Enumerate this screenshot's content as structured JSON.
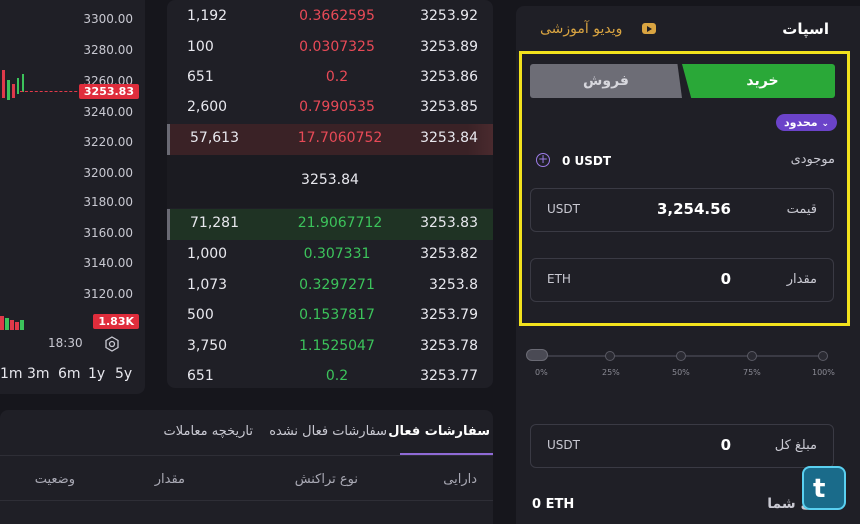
{
  "chart": {
    "y_ticks": [
      "3300.00",
      "3280.00",
      "3260.00",
      "3240.00",
      "3220.00",
      "3200.00",
      "3180.00",
      "3160.00",
      "3140.00",
      "3120.00"
    ],
    "last_price_tag": "3253.83",
    "volume_tag": "1.83K",
    "time_label": "18:30",
    "timeframes": [
      "1m",
      "3m",
      "6m",
      "1y",
      "5y"
    ]
  },
  "order_book": {
    "asks": [
      {
        "amount": "1,192",
        "total": "0.3662595",
        "price": "3253.92"
      },
      {
        "amount": "100",
        "total": "0.0307325",
        "price": "3253.89"
      },
      {
        "amount": "651",
        "total": "0.2",
        "price": "3253.86"
      },
      {
        "amount": "2,600",
        "total": "0.7990535",
        "price": "3253.85"
      },
      {
        "amount": "57,613",
        "total": "17.7060752",
        "price": "3253.84"
      }
    ],
    "mid_price": "3253.84",
    "bids": [
      {
        "amount": "71,281",
        "total": "21.9067712",
        "price": "3253.83"
      },
      {
        "amount": "1,000",
        "total": "0.307331",
        "price": "3253.82"
      },
      {
        "amount": "1,073",
        "total": "0.3297271",
        "price": "3253.8"
      },
      {
        "amount": "500",
        "total": "0.1537817",
        "price": "3253.79"
      },
      {
        "amount": "3,750",
        "total": "1.1525047",
        "price": "3253.78"
      },
      {
        "amount": "651",
        "total": "0.2",
        "price": "3253.77"
      }
    ]
  },
  "orders": {
    "tabs": {
      "active": "سفارشات فعال",
      "inactive": "سفارشات فعال نشده",
      "history": "تاریخچه معاملات"
    },
    "columns": {
      "asset": "دارایی",
      "type": "نوع تراکنش",
      "amount": "مقدار",
      "status": "وضعیت"
    }
  },
  "spot": {
    "title": "اسپات",
    "video_link": "ویدیو آموزشی",
    "buy_label": "خرید",
    "sell_label": "فروش",
    "order_type": "محدود",
    "balance_label": "موجودی",
    "balance_value": "0 USDT",
    "price_label": "قیمت",
    "price_value": "3,254.56",
    "price_unit": "USDT",
    "amount_label": "مقدار",
    "amount_value": "0",
    "amount_unit": "ETH",
    "slider_marks": [
      "0%",
      "25%",
      "50%",
      "75%",
      "100%"
    ],
    "total_label": "مبلغ کل",
    "total_value": "0",
    "total_unit": "USDT",
    "your_asset_label": "تی شما",
    "eth_balance": "0 ETH"
  },
  "colors": {
    "buy": "#2aa838",
    "sell_text": "#e84a57",
    "buy_text": "#3cc35b",
    "accent": "#6b43c9",
    "highlight": "#f2e21d"
  }
}
